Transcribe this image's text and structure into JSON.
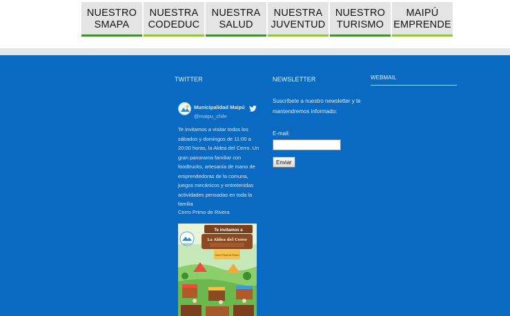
{
  "nav": {
    "tabs": [
      {
        "line1": "NUESTRO",
        "line2": "SMAPA"
      },
      {
        "line1": "NUESTRA",
        "line2": "CODEDUC"
      },
      {
        "line1": "NUESTRA",
        "line2": "SALUD"
      },
      {
        "line1": "NUESTRA",
        "line2": "JUVENTUD"
      },
      {
        "line1": "NUESTRO",
        "line2": "TURISMO"
      },
      {
        "line1": "MAIPÚ",
        "line2": "EMPRENDE"
      }
    ]
  },
  "twitter": {
    "title": "TWITTER",
    "account_name": "Municipalidad Maipú",
    "handle": "@maipu_chile",
    "tweet_text": "Te invitamos a visitar todos los sábados y domingos de 11:00 a 20:00 horas, la Aldea del Cerro. Un gran panorama familiar con foodtrucks, artesanía de mano de emprendedoras de la comuna, juegos mecánicos y entretenidas actividades pensadas en toda la familia",
    "tweet_place": "Cerro Primo de Rivera",
    "bird_icon": "twitter-bird-icon",
    "image": {
      "banner_text": "Te invitamos a",
      "title_text": "La Aldea del Cerro",
      "sign_text": "Cerro Primo de Rivera",
      "logo_text": "MAIPÚ"
    }
  },
  "newsletter": {
    "title": "NEWSLETTER",
    "description": "Suscríbete a nuestro newsletter y te mantendremos informado:",
    "email_label": "E-mail:",
    "email_value": "",
    "submit_label": "Enviar"
  },
  "webmail": {
    "title": "WEBMAIL"
  },
  "colors": {
    "footer_bg": "#0a6ac2",
    "nav_tab_bg": "#e4e4e4",
    "nav_border_dark": "#3f8f2c",
    "nav_border_light": "#8ec63f"
  }
}
